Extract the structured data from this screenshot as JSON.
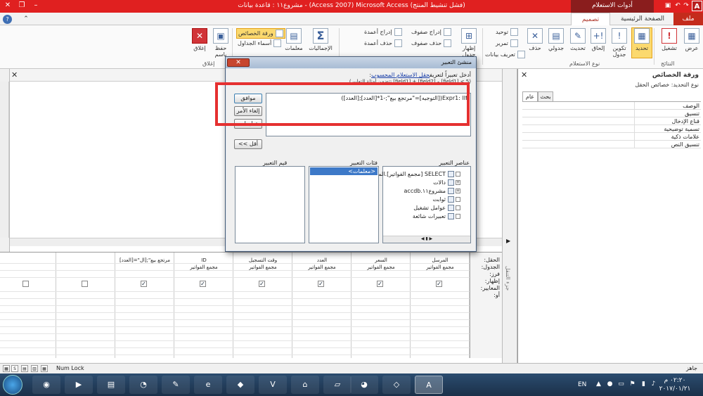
{
  "titlebar": {
    "title": "مشروع١١ : قاعدة بيانات - (Access 2007) Microsoft Access  (فشل تنشيط المنتج)",
    "context_tools": "أدوات الاستعلام",
    "app_logo": "A"
  },
  "tabs": {
    "file": "ملف",
    "home": "الصفحة الرئيسية",
    "design": "تصميم"
  },
  "ribbon": {
    "view": "عرض",
    "run": "تشغيل",
    "select": "تحديد",
    "make_table": "تكوين جدول",
    "append": "إلحاق",
    "update": "تحديث",
    "crosstab": "جدولي",
    "delete": "حذف",
    "union": "توحيد",
    "pass_through": "تمرير",
    "data_definition": "تعريف بيانات",
    "show_table": "إظهار جدول",
    "insert_rows": "إدراج صفوف",
    "delete_rows": "حذف صفوف",
    "builder": "منشئ",
    "insert_columns": "إدراج أعمدة",
    "delete_columns": "حذف أعمدة",
    "return": "الإرجاع: الكل",
    "totals": "الإجماليات",
    "parameters": "معلمات",
    "property_sheet": "ورقة الخصائص",
    "table_names": "أسماء الجداول",
    "save_as": "حفظ باسم",
    "close": "إغلاق",
    "group_results": "النتائج",
    "group_query_type": "نوع الاستعلام",
    "group_close": "إغلاق"
  },
  "property_sheet": {
    "title": "ورقة الخصائص",
    "selection_type": "نوع التحديد:  خصائص الحقل",
    "tab_general": "عام",
    "tab_lookup": "بحث",
    "rows": [
      "الوصف",
      "تنسيق",
      "قناع الإدخال",
      "تسمية توضيحية",
      "علامات ذكية",
      "تنسيق النص"
    ]
  },
  "nav_pane_label": "جزء التنقل",
  "dialog": {
    "title": "منشئ التعبير",
    "prompt_prefix": "أدخل تعبيراً لتعريف",
    "prompt_link": "حقل الاستعلام المحسوب",
    "prompt_suffix": ":",
    "example": "(تتضمن أمثلة التعابير [field1] + [field2] و [field1] < 5)",
    "expression": "Expr1: IIf([التوجيه]=\"مرتجع بيع\";-1*[العدد];[العدد])",
    "btn_ok": "موافق",
    "btn_cancel": "إلغاء الأمر",
    "btn_help": "تعليمات",
    "btn_less": "<< أقل",
    "label_elements": "عناصر التعبير",
    "label_categories": "فئات التعبير",
    "label_values": "قيم التعبير",
    "elements": [
      "SELECT [مجمع الفواتير].الم",
      "دالات",
      "مشروع١١.accdb",
      "ثوابت",
      "عوامل تشغيل",
      "تعبيرات شائعة"
    ],
    "category_selected": "<معلمات>"
  },
  "qbe": {
    "row_labels": [
      "الحقل:",
      "الجدول:",
      "فرز:",
      "إظهار:",
      "المعايير:",
      "أو:"
    ],
    "columns": [
      {
        "field": "المرسل",
        "table": "مجمع الفواتير",
        "show": true
      },
      {
        "field": "السعر",
        "table": "مجمع الفواتير",
        "show": true
      },
      {
        "field": "العدد",
        "table": "مجمع الفواتير",
        "show": true
      },
      {
        "field": "وقت التسجيل",
        "table": "مجمع الفواتير",
        "show": true
      },
      {
        "field": "ID",
        "table": "مجمع الفواتير",
        "show": true
      },
      {
        "field": "[العدد]=\"مرتجع بيع\";[ال",
        "table": "",
        "show": true
      },
      {
        "field": "",
        "table": "",
        "show": false
      },
      {
        "field": "",
        "table": "",
        "show": false
      }
    ]
  },
  "statusbar": {
    "numlock": "Num Lock",
    "ready": "جاهز"
  },
  "taskbar": {
    "lang": "EN",
    "time": "٠٢:٢٠ م",
    "date": "٢٠١٧/٠١/٢١"
  }
}
